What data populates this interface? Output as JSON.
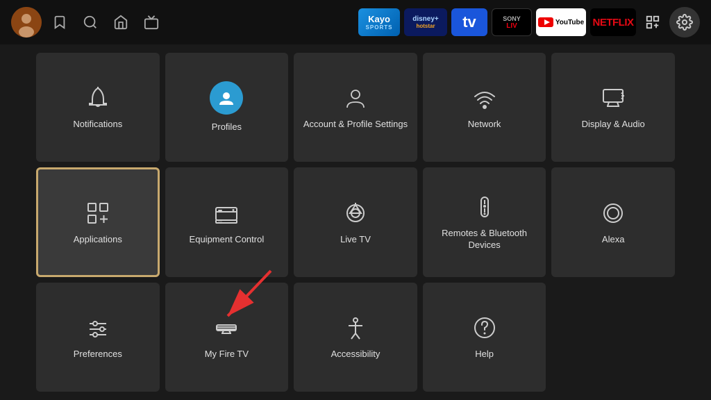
{
  "nav": {
    "icons": [
      "🔖",
      "🔍",
      "🏠",
      "📺"
    ],
    "apps": [
      {
        "name": "Kayo",
        "label": "Kayo",
        "sublabel": "sports",
        "style": "kayo"
      },
      {
        "name": "Disney Hotstar",
        "label": "disney+\nhotstar",
        "style": "disney"
      },
      {
        "name": "TV",
        "label": "tv",
        "style": "tv"
      },
      {
        "name": "Sony Liv",
        "label": "SONY\nLIV",
        "style": "sony"
      },
      {
        "name": "YouTube",
        "label": "▶ YouTube",
        "style": "youtube"
      },
      {
        "name": "Netflix",
        "label": "NETFLIX",
        "style": "netflix"
      }
    ],
    "settings_icon": "⚙"
  },
  "tiles": [
    {
      "id": "notifications",
      "label": "Notifications",
      "icon": "bell",
      "selected": false,
      "row": 1,
      "col": 1
    },
    {
      "id": "profiles",
      "label": "Profiles",
      "icon": "person-circle",
      "selected": false,
      "row": 1,
      "col": 2
    },
    {
      "id": "account-profile-settings",
      "label": "Account & Profile Settings",
      "icon": "person-outline",
      "selected": false,
      "row": 1,
      "col": 3
    },
    {
      "id": "network",
      "label": "Network",
      "icon": "wifi",
      "selected": false,
      "row": 1,
      "col": 4
    },
    {
      "id": "display-audio",
      "label": "Display & Audio",
      "icon": "display",
      "selected": false,
      "row": 1,
      "col": 5
    },
    {
      "id": "applications",
      "label": "Applications",
      "icon": "apps",
      "selected": true,
      "row": 2,
      "col": 1
    },
    {
      "id": "equipment-control",
      "label": "Equipment Control",
      "icon": "monitor",
      "selected": false,
      "row": 2,
      "col": 2
    },
    {
      "id": "live-tv",
      "label": "Live TV",
      "icon": "antenna",
      "selected": false,
      "row": 2,
      "col": 3
    },
    {
      "id": "remotes-bluetooth",
      "label": "Remotes & Bluetooth Devices",
      "icon": "remote",
      "selected": false,
      "row": 2,
      "col": 4
    },
    {
      "id": "alexa",
      "label": "Alexa",
      "icon": "alexa",
      "selected": false,
      "row": 2,
      "col": 5
    },
    {
      "id": "preferences",
      "label": "Preferences",
      "icon": "sliders",
      "selected": false,
      "row": 3,
      "col": 1
    },
    {
      "id": "my-fire-tv",
      "label": "My Fire TV",
      "icon": "fire-tv",
      "selected": false,
      "row": 3,
      "col": 2
    },
    {
      "id": "accessibility",
      "label": "Accessibility",
      "icon": "accessibility",
      "selected": false,
      "row": 3,
      "col": 3
    },
    {
      "id": "help",
      "label": "Help",
      "icon": "help",
      "selected": false,
      "row": 3,
      "col": 4
    }
  ]
}
